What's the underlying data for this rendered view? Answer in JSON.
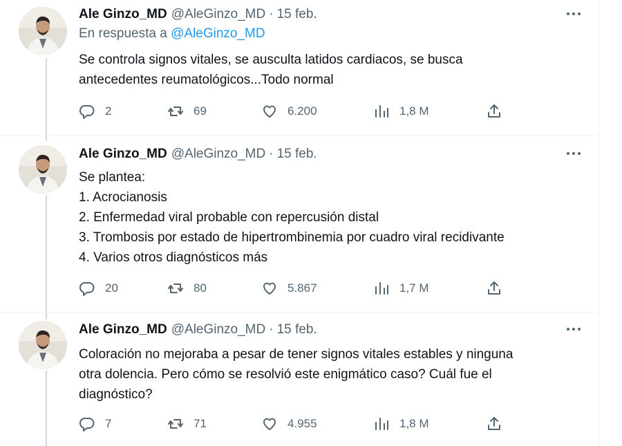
{
  "tweets": [
    {
      "name": "Ale Ginzo_MD",
      "handle": "@AleGinzo_MD",
      "dot": "·",
      "date": "15 feb.",
      "reply_prefix": "En respuesta a",
      "reply_mention": "@AleGinzo_MD",
      "text": "Se controla signos vitales, se ausculta latidos cardiacos, se busca\nantecedentes reumatológicos...Todo normal",
      "replies": "2",
      "retweets": "69",
      "likes": "6.200",
      "views": "1,8 M"
    },
    {
      "name": "Ale Ginzo_MD",
      "handle": "@AleGinzo_MD",
      "dot": "·",
      "date": "15 feb.",
      "text": "Se plantea:\n1. Acrocianosis\n2. Enfermedad viral probable con repercusión distal\n3. Trombosis por estado de hipertrombinemia por cuadro viral recidivante\n4. Varios otros diagnósticos más",
      "replies": "20",
      "retweets": "80",
      "likes": "5.867",
      "views": "1,7 M"
    },
    {
      "name": "Ale Ginzo_MD",
      "handle": "@AleGinzo_MD",
      "dot": "·",
      "date": "15 feb.",
      "text": "Coloración no mejoraba a pesar de tener signos vitales estables y ninguna\notra dolencia. Pero cómo se resolvió este enigmático caso? Cuál fue el\ndiagnóstico?",
      "replies": "7",
      "retweets": "71",
      "likes": "4.955",
      "views": "1,8 M"
    }
  ],
  "icons": {
    "reply": "reply-icon",
    "retweet": "retweet-icon",
    "like": "heart-icon",
    "views": "views-icon",
    "share": "share-icon",
    "more": "more-options-icon"
  },
  "colors": {
    "text": "#0f1419",
    "secondary": "#536471",
    "link": "#1d9bf0",
    "thread_line": "#cfd9de"
  }
}
